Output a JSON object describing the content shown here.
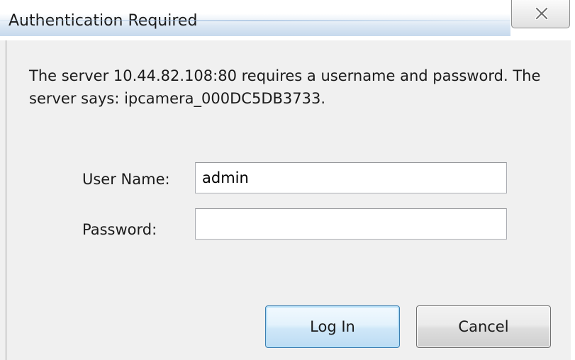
{
  "window": {
    "title": "Authentication Required",
    "close_icon": "close-x-icon"
  },
  "message": "The server 10.44.82.108:80 requires a username and password. The server says: ipcamera_000DC5DB3733.",
  "form": {
    "username_label": "User Name:",
    "username_value": "admin",
    "password_label": "Password:",
    "password_value": ""
  },
  "buttons": {
    "login_label": "Log In",
    "cancel_label": "Cancel"
  }
}
